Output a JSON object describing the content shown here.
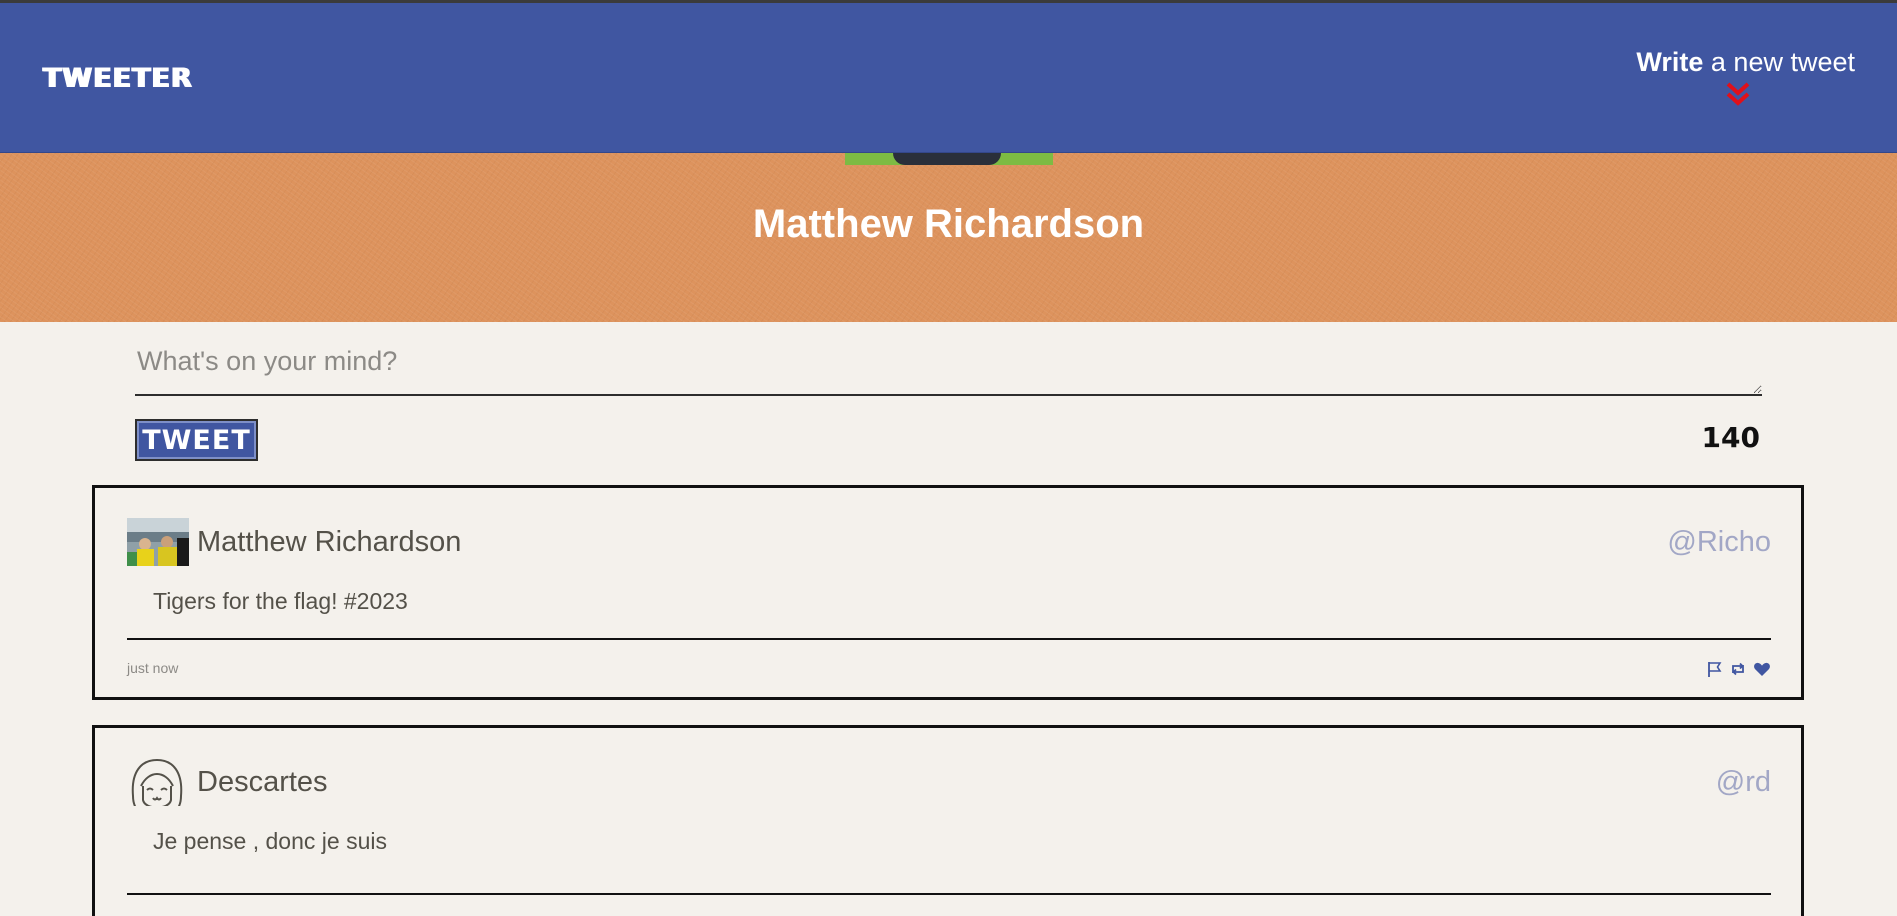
{
  "nav": {
    "logo": "TWEETER",
    "compose_bold": "Write",
    "compose_rest": " a new tweet",
    "arrow_icon": "double-chevron-down-icon",
    "arrow_color": "#e0101a"
  },
  "profile": {
    "name": "Matthew Richardson"
  },
  "new_tweet": {
    "placeholder": "What's on your mind?",
    "button_label": "TWEET",
    "counter": "140"
  },
  "tweets": [
    {
      "author": "Matthew Richardson",
      "handle": "@Richo",
      "text": "Tigers for the flag! #2023",
      "time": "just now",
      "icons": [
        "flag-icon",
        "retweet-icon",
        "heart-icon"
      ]
    },
    {
      "author": "Descartes",
      "handle": "@rd",
      "text": "Je pense , donc je suis"
    }
  ],
  "colors": {
    "nav_bg": "#4056a1",
    "banner_bg": "#dd935d",
    "page_bg": "#f4f1ec",
    "handle": "#a2a7c6",
    "icon": "#4056a1"
  }
}
